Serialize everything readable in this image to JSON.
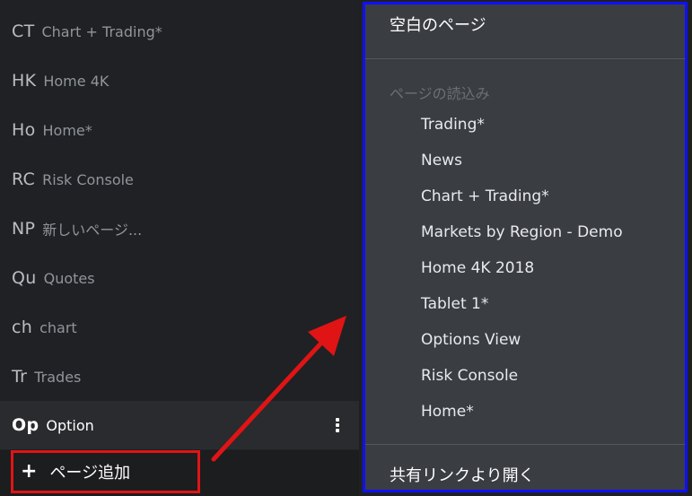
{
  "sidebar": {
    "pages": [
      {
        "abbr": "CT",
        "name": "Chart + Trading*"
      },
      {
        "abbr": "HK",
        "name": "Home 4K"
      },
      {
        "abbr": "Ho",
        "name": "Home*"
      },
      {
        "abbr": "RC",
        "name": "Risk Console"
      },
      {
        "abbr": "NP",
        "name": "新しいページ..."
      },
      {
        "abbr": "Qu",
        "name": "Quotes"
      },
      {
        "abbr": "ch",
        "name": "chart"
      },
      {
        "abbr": "Tr",
        "name": "Trades"
      },
      {
        "abbr": "Op",
        "name": "Option"
      }
    ],
    "add_page_label": "ページ追加",
    "add_icon": "+"
  },
  "menu": {
    "blank_page": "空白のページ",
    "load_section_label": "ページの読込み",
    "load_items": [
      "Trading*",
      "News",
      "Chart + Trading*",
      "Markets by Region - Demo",
      "Home 4K 2018",
      "Tablet 1*",
      "Options View",
      "Risk Console",
      "Home*"
    ],
    "open_shared_link": "共有リンクより開く"
  },
  "colors": {
    "highlight_red": "#e01414",
    "highlight_blue": "#1010ff",
    "menu_bg": "#3a3d42",
    "sidebar_bg": "#202124"
  }
}
